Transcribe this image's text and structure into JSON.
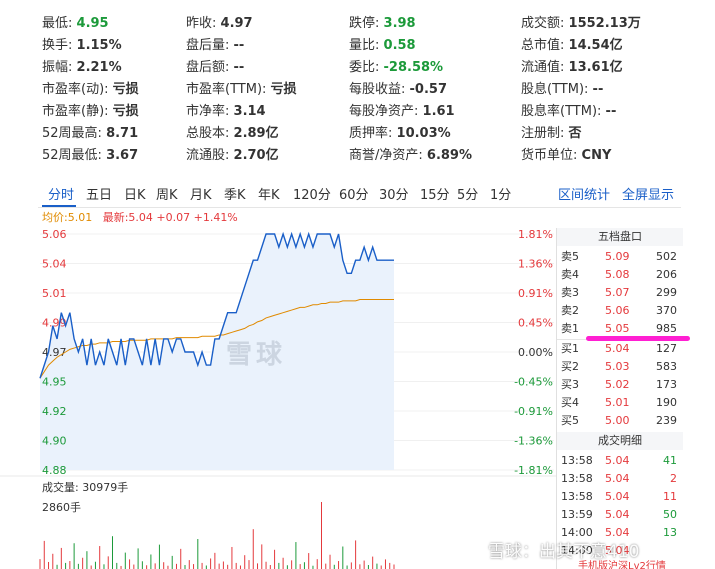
{
  "stats": {
    "rows": [
      [
        {
          "label": "最低:",
          "value": "4.95",
          "tone": "down"
        },
        {
          "label": "昨收:",
          "value": "4.97",
          "tone": ""
        },
        {
          "label": "跌停:",
          "value": "3.98",
          "tone": "down"
        },
        {
          "label": "成交额:",
          "value": "1552.13万",
          "tone": ""
        }
      ],
      [
        {
          "label": "换手:",
          "value": "1.15%",
          "tone": ""
        },
        {
          "label": "盘后量:",
          "value": "--",
          "tone": ""
        },
        {
          "label": "量比:",
          "value": "0.58",
          "tone": "down"
        },
        {
          "label": "总市值:",
          "value": "14.54亿",
          "tone": ""
        }
      ],
      [
        {
          "label": "振幅:",
          "value": "2.21%",
          "tone": ""
        },
        {
          "label": "盘后额:",
          "value": "--",
          "tone": ""
        },
        {
          "label": "委比:",
          "value": "-28.58%",
          "tone": "down"
        },
        {
          "label": "流通值:",
          "value": "13.61亿",
          "tone": ""
        }
      ],
      [
        {
          "label": "市盈率(动):",
          "value": "亏损",
          "tone": ""
        },
        {
          "label": "市盈率(TTM):",
          "value": "亏损",
          "tone": ""
        },
        {
          "label": "每股收益:",
          "value": "-0.57",
          "tone": ""
        },
        {
          "label": "股息(TTM):",
          "value": "--",
          "tone": ""
        }
      ],
      [
        {
          "label": "市盈率(静):",
          "value": "亏损",
          "tone": ""
        },
        {
          "label": "市净率:",
          "value": "3.14",
          "tone": ""
        },
        {
          "label": "每股净资产:",
          "value": "1.61",
          "tone": ""
        },
        {
          "label": "股息率(TTM):",
          "value": "--",
          "tone": ""
        }
      ],
      [
        {
          "label": "52周最高:",
          "value": "8.71",
          "tone": ""
        },
        {
          "label": "总股本:",
          "value": "2.89亿",
          "tone": ""
        },
        {
          "label": "质押率:",
          "value": "10.03%",
          "tone": ""
        },
        {
          "label": "注册制:",
          "value": "否",
          "tone": ""
        }
      ],
      [
        {
          "label": "52周最低:",
          "value": "3.67",
          "tone": ""
        },
        {
          "label": "流通股:",
          "value": "2.70亿",
          "tone": ""
        },
        {
          "label": "商誉/净资产:",
          "value": "6.89%",
          "tone": ""
        },
        {
          "label": "货币单位:",
          "value": "CNY",
          "tone": ""
        }
      ]
    ]
  },
  "tabs": {
    "items": [
      "分时",
      "五日",
      "日K",
      "周K",
      "月K",
      "季K",
      "年K",
      "120分",
      "60分",
      "30分",
      "15分",
      "5分",
      "1分"
    ],
    "active": "分时",
    "right": [
      "区间统计",
      "全屏显示"
    ]
  },
  "legend": {
    "avg_label": "均价:5.01",
    "last_label": "最新:5.04 +0.07 +1.41%"
  },
  "chart_data": {
    "type": "line",
    "prev_close": 4.97,
    "ylim": [
      4.88,
      5.06
    ],
    "price_ticks": [
      "5.06",
      "5.04",
      "5.01",
      "4.99",
      "4.97",
      "4.95",
      "4.92",
      "4.90",
      "4.88"
    ],
    "pct_ticks": [
      "1.81%",
      "1.36%",
      "0.91%",
      "0.45%",
      "0.00%",
      "-0.45%",
      "-0.91%",
      "-1.36%",
      "-1.81%"
    ],
    "series": [
      {
        "values": [
          4.95,
          4.96,
          4.97,
          4.99,
          4.98,
          5.0,
          4.99,
          5.0,
          4.98,
          4.97,
          4.98,
          4.96,
          4.98,
          4.96,
          4.97,
          4.96,
          4.98,
          4.97,
          4.96,
          4.98,
          4.96,
          4.98,
          4.98,
          4.97,
          4.96,
          4.98,
          4.96,
          4.98,
          4.96,
          4.98,
          4.98,
          4.97,
          4.98,
          4.98,
          4.97,
          4.97,
          4.97,
          4.96,
          4.97,
          4.96,
          4.96,
          4.98,
          4.98,
          4.99,
          5.0,
          5.0,
          5.0,
          5.01,
          5.02,
          5.03,
          5.04,
          5.04,
          5.05,
          5.06,
          5.06,
          5.06,
          5.05,
          5.06,
          5.05,
          5.06,
          5.05,
          5.06,
          5.05,
          5.06,
          5.05,
          5.06,
          5.06,
          5.06,
          5.06,
          5.05,
          5.06,
          5.04,
          5.03,
          5.03,
          5.04,
          5.04,
          5.05,
          5.04,
          5.05,
          5.04,
          5.04,
          5.04,
          5.04,
          5.04
        ]
      },
      {
        "values": [
          4.95,
          4.955,
          4.96,
          4.963,
          4.966,
          4.968,
          4.97,
          4.972,
          4.973,
          4.974,
          4.975,
          4.975,
          4.976,
          4.976,
          4.977,
          4.977,
          4.977,
          4.978,
          4.978,
          4.978,
          4.978,
          4.979,
          4.979,
          4.979,
          4.979,
          4.979,
          4.98,
          4.98,
          4.98,
          4.98,
          4.98,
          4.98,
          4.981,
          4.981,
          4.981,
          4.981,
          4.981,
          4.981,
          4.982,
          4.982,
          4.982,
          4.982,
          4.983,
          4.983,
          4.984,
          4.985,
          4.986,
          4.987,
          4.988,
          4.99,
          4.991,
          4.993,
          4.994,
          4.996,
          4.997,
          4.998,
          4.999,
          5.0,
          5.001,
          5.002,
          5.003,
          5.004,
          5.004,
          5.005,
          5.006,
          5.006,
          5.007,
          5.007,
          5.008,
          5.008,
          5.008,
          5.009,
          5.009,
          5.009,
          5.009,
          5.01,
          5.01,
          5.01,
          5.01,
          5.01,
          5.01,
          5.01,
          5.01,
          5.01
        ]
      }
    ],
    "volume": {
      "label": "成交量: 30979手",
      "max_label": "2860手",
      "values": [
        420,
        1200,
        300,
        650,
        180,
        900,
        260,
        340,
        1100,
        220,
        480,
        760,
        150,
        310,
        980,
        200,
        540,
        1400,
        260,
        130,
        700,
        410,
        190,
        880,
        330,
        160,
        620,
        240,
        1040,
        290,
        140,
        560,
        220,
        860,
        170,
        380,
        210,
        1280,
        260,
        150,
        450,
        690,
        230,
        320,
        180,
        940,
        260,
        150,
        590,
        380,
        1700,
        240,
        1050,
        310,
        170,
        820,
        260,
        480,
        160,
        370,
        1150,
        210,
        290,
        680,
        140,
        420,
        2860,
        230,
        610,
        180,
        340,
        960,
        150,
        280,
        1220,
        200,
        360,
        170,
        530,
        230,
        150,
        410,
        260,
        190
      ]
    }
  },
  "orderbook": {
    "title": "五档盘口",
    "asks": [
      {
        "label": "卖5",
        "price": "5.09",
        "volume": "502"
      },
      {
        "label": "卖4",
        "price": "5.08",
        "volume": "206"
      },
      {
        "label": "卖3",
        "price": "5.07",
        "volume": "299"
      },
      {
        "label": "卖2",
        "price": "5.06",
        "volume": "370"
      },
      {
        "label": "卖1",
        "price": "5.05",
        "volume": "985"
      }
    ],
    "bids": [
      {
        "label": "买1",
        "price": "5.04",
        "volume": "127"
      },
      {
        "label": "买2",
        "price": "5.03",
        "volume": "583"
      },
      {
        "label": "买3",
        "price": "5.02",
        "volume": "173"
      },
      {
        "label": "买4",
        "price": "5.01",
        "volume": "190"
      },
      {
        "label": "买5",
        "price": "5.00",
        "volume": "239"
      }
    ],
    "trades_title": "成交明细",
    "trades": [
      {
        "time": "13:58",
        "price": "5.04",
        "volume": "41",
        "tone": "down"
      },
      {
        "time": "13:58",
        "price": "5.04",
        "volume": "2",
        "tone": "up"
      },
      {
        "time": "13:58",
        "price": "5.04",
        "volume": "11",
        "tone": "up"
      },
      {
        "time": "13:59",
        "price": "5.04",
        "volume": "50",
        "tone": "down"
      },
      {
        "time": "14:00",
        "price": "5.04",
        "volume": "13",
        "tone": "down"
      },
      {
        "time": "14:00",
        "price": "5.04",
        "volume": "",
        "tone": "up"
      }
    ],
    "footer": "手机版沪深Lv2行情"
  },
  "watermarks": {
    "center": "雪球",
    "bottom": "雪球：出其不意410"
  },
  "colors": {
    "up": "#e4393c",
    "down": "#1c9a3a",
    "price_line": "#1a5fc8",
    "avg_line": "#e08a00",
    "area_fill": "#eaf2fc",
    "highlight": "#ff1fd2"
  }
}
